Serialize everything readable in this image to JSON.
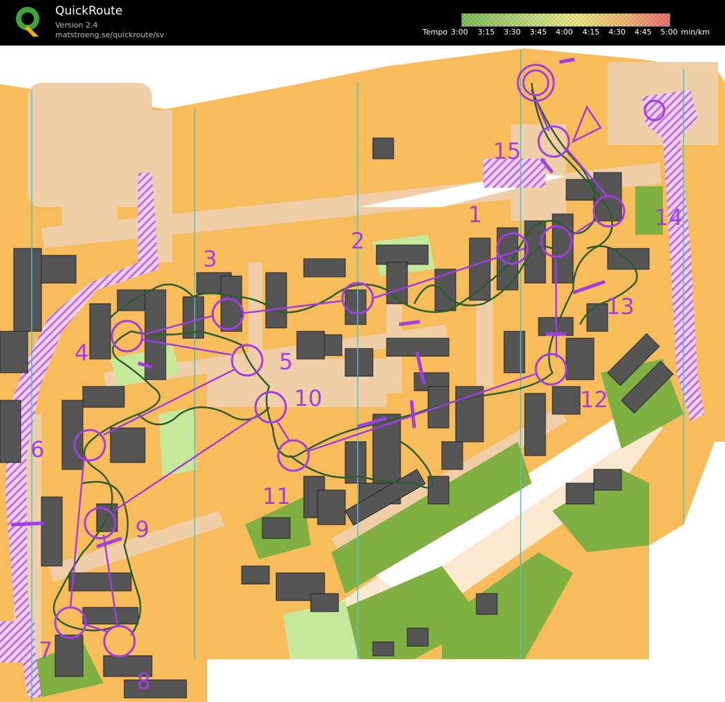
{
  "app": {
    "name": "QuickRoute",
    "version": "Version 2.4",
    "url": "matstroeng.se/quickroute/sv"
  },
  "tempo": {
    "label": "Tempo",
    "values": [
      "3:00",
      "3:15",
      "3:30",
      "3:45",
      "4:00",
      "4:15",
      "4:30",
      "4:45",
      "5:00"
    ],
    "unit": "min/km"
  },
  "map": {
    "control_numbers": [
      "1",
      "2",
      "3",
      "4",
      "5",
      "6",
      "7",
      "8",
      "9",
      "10",
      "11",
      "12",
      "13",
      "14",
      "15"
    ]
  },
  "colors": {
    "course": "#a03ee0",
    "route": "#2b5e2b",
    "open_land": "#f8bc5a",
    "building": "#555555",
    "vegetation": "#7fb041",
    "paved": "#f0cfa8",
    "grid_line": "#4ec3c8"
  }
}
